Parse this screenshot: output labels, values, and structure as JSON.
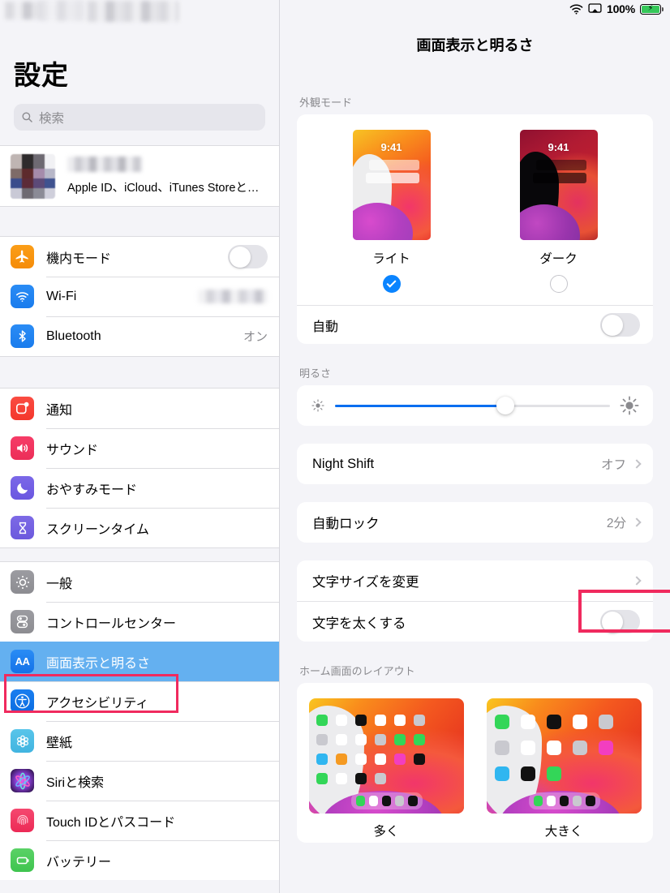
{
  "sidebar": {
    "title": "設定",
    "search": {
      "placeholder": "検索",
      "icon": "search-icon"
    },
    "account": {
      "subtitle": "Apple ID、iCloud、iTunes Storeと…",
      "name_redacted": true
    },
    "groups": [
      {
        "items": [
          {
            "label": "機内モード",
            "icon": "airplane-icon",
            "icon_class": "ic-plane",
            "glyph": "✈",
            "control": "toggle",
            "toggle_on": false
          },
          {
            "label": "Wi-Fi",
            "icon": "wifi-icon",
            "icon_class": "ic-wifi",
            "glyph": "wifi",
            "control": "redacted"
          },
          {
            "label": "Bluetooth",
            "icon": "bluetooth-icon",
            "icon_class": "ic-bt",
            "glyph": "bt",
            "control": "value",
            "value": "オン"
          }
        ]
      },
      {
        "items": [
          {
            "label": "通知",
            "icon": "notifications-icon",
            "icon_class": "ic-notif",
            "glyph": "notif",
            "control": "none"
          },
          {
            "label": "サウンド",
            "icon": "sound-icon",
            "icon_class": "ic-sound",
            "glyph": "🔊",
            "control": "none"
          },
          {
            "label": "おやすみモード",
            "icon": "moon-icon",
            "icon_class": "ic-dnd",
            "glyph": "🌙",
            "control": "none"
          },
          {
            "label": "スクリーンタイム",
            "icon": "hourglass-icon",
            "icon_class": "ic-screen",
            "glyph": "⌛",
            "control": "none"
          }
        ]
      },
      {
        "items": [
          {
            "label": "一般",
            "icon": "gear-icon",
            "icon_class": "ic-gen",
            "glyph": "gear",
            "control": "none"
          },
          {
            "label": "コントロールセンター",
            "icon": "control-center-icon",
            "icon_class": "ic-cc",
            "glyph": "cc",
            "control": "none"
          },
          {
            "label": "画面表示と明るさ",
            "icon": "display-brightness-icon",
            "icon_class": "ic-disp",
            "glyph": "AA",
            "control": "none",
            "selected": true,
            "highlighted": true
          },
          {
            "label": "アクセシビリティ",
            "icon": "accessibility-icon",
            "icon_class": "ic-acc",
            "glyph": "acc",
            "control": "none"
          },
          {
            "label": "壁紙",
            "icon": "wallpaper-icon",
            "icon_class": "ic-wall",
            "glyph": "flower",
            "control": "none"
          },
          {
            "label": "Siriと検索",
            "icon": "siri-icon",
            "icon_class": "ic-siri",
            "glyph": "siri",
            "control": "none"
          },
          {
            "label": "Touch IDとパスコード",
            "icon": "touchid-icon",
            "icon_class": "ic-touch",
            "glyph": "fingerprint",
            "control": "none"
          },
          {
            "label": "バッテリー",
            "icon": "battery-icon",
            "icon_class": "ic-batt",
            "glyph": "battery",
            "control": "none"
          }
        ]
      }
    ]
  },
  "statusbar": {
    "wifi_icon": "wifi-icon",
    "airplay_icon": "airplay-icon",
    "battery_percent": "100%",
    "battery_icon": "battery-charging-icon"
  },
  "detail": {
    "title": "画面表示と明るさ",
    "sections": {
      "appearance": {
        "header": "外観モード",
        "options": [
          {
            "label": "ライト",
            "clock": "9:41",
            "selected": true
          },
          {
            "label": "ダーク",
            "clock": "9:41",
            "selected": false
          }
        ],
        "auto": {
          "label": "自動",
          "toggle_on": false
        }
      },
      "brightness": {
        "header": "明るさ",
        "low_icon": "brightness-low-icon",
        "high_icon": "brightness-high-icon",
        "value_percent": 62
      },
      "night_shift": {
        "label": "Night Shift",
        "value": "オフ"
      },
      "auto_lock": {
        "label": "自動ロック",
        "value": "2分"
      },
      "text": {
        "size_label": "文字サイズを変更",
        "size_highlighted": true,
        "bold_label": "文字を太くする",
        "bold_toggle_on": false
      },
      "home_layout": {
        "header": "ホーム画面のレイアウト",
        "options": [
          {
            "label": "多く",
            "selected": false
          },
          {
            "label": "大きく",
            "selected": false
          }
        ]
      }
    }
  },
  "colors": {
    "accent_blue": "#0a84ff",
    "selection_blue": "#64b0f0",
    "highlight_red": "#f02a5e",
    "battery_green": "#35c759",
    "page_bg": "#f4f4f8"
  }
}
